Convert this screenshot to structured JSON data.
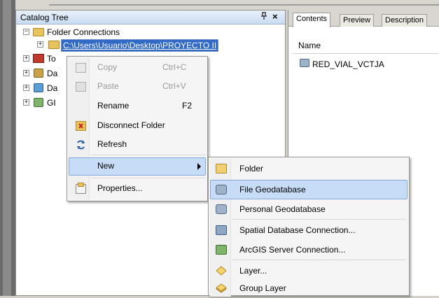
{
  "catalog_tree": {
    "title": "Catalog Tree",
    "pin_glyph": "p",
    "close_glyph": "×",
    "root": {
      "label": "Folder Connections",
      "expander": "−"
    },
    "selected_path": "C:\\Users\\Usuario\\Desktop\\PROYECTO II",
    "children_partial": [
      {
        "label": "To",
        "icon": "toolbox-icon"
      },
      {
        "label": "Da",
        "icon": "database-servers-icon"
      },
      {
        "label": "Da",
        "icon": "database-connections-icon"
      },
      {
        "label": "GI",
        "icon": "gis-servers-icon"
      }
    ],
    "expander_plus": "+"
  },
  "contents_panel": {
    "tabs": [
      "Contents",
      "Preview",
      "Description"
    ],
    "active_tab": "Contents",
    "column_header": "Name",
    "items": [
      {
        "label": "RED_VIAL_VCTJA",
        "icon": "geodatabase-icon"
      }
    ]
  },
  "context_menu": {
    "items": [
      {
        "label": "Copy",
        "shortcut": "Ctrl+C",
        "enabled": false,
        "icon": "copy-icon"
      },
      {
        "label": "Paste",
        "shortcut": "Ctrl+V",
        "enabled": false,
        "icon": "paste-icon"
      },
      {
        "label": "Rename",
        "shortcut": "F2",
        "enabled": true,
        "icon": ""
      },
      {
        "label": "Disconnect Folder",
        "shortcut": "",
        "enabled": true,
        "icon": "disconnect-folder-icon"
      },
      {
        "label": "Refresh",
        "shortcut": "",
        "enabled": true,
        "icon": "refresh-icon"
      },
      {
        "label": "New",
        "shortcut": "",
        "enabled": true,
        "icon": "",
        "submenu": true,
        "highlighted": true
      },
      {
        "label": "Properties...",
        "shortcut": "",
        "enabled": true,
        "icon": "properties-icon"
      }
    ]
  },
  "new_submenu": {
    "items": [
      {
        "label": "Folder",
        "icon": "folder-icon"
      },
      {
        "label": "File Geodatabase",
        "icon": "file-geodatabase-icon",
        "highlighted": true
      },
      {
        "label": "Personal Geodatabase",
        "icon": "personal-geodatabase-icon"
      },
      {
        "label": "Spatial Database Connection...",
        "icon": "spatial-database-connection-icon"
      },
      {
        "label": "ArcGIS Server Connection...",
        "icon": "arcgis-server-connection-icon"
      },
      {
        "label": "Layer...",
        "icon": "layer-icon"
      },
      {
        "label": "Group Layer",
        "icon": "group-layer-icon"
      }
    ]
  },
  "colors": {
    "highlight": "#c7ddf7",
    "highlight_border": "#82a8dc",
    "selected_path_bg": "#3169c6"
  }
}
